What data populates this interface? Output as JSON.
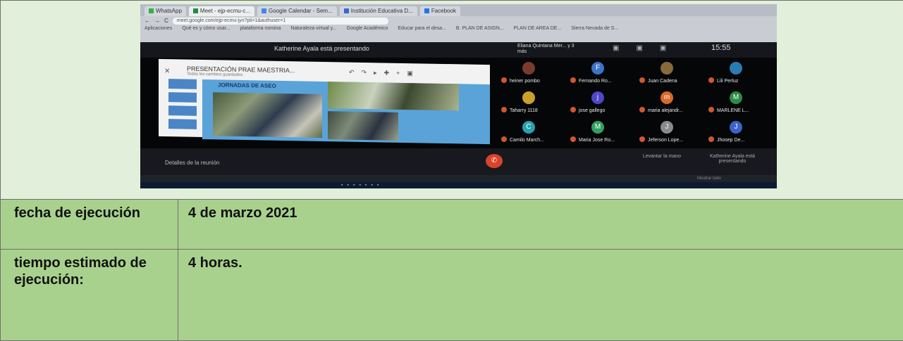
{
  "browser": {
    "tabs": [
      "WhatsApp",
      "Meet - ejp-ecmu-c...",
      "Google Calendar - Sem...",
      "Institución Educativa D...",
      "Facebook"
    ],
    "url": "meet.google.com/ejp-ecmu-jyn?pli=1&authuser=1",
    "bookmarks": [
      "Aplicaciones",
      "Qué es y cómo usar...",
      "plataforma nomina",
      "Naturaleza virtual y...",
      "Google Académico",
      "Educar para el desa...",
      "B. PLAN DE ASIGN...",
      "PLAN DE AREA DE...",
      "Sierra Nevada de S..."
    ]
  },
  "meet": {
    "presenting_text": "Katherine Ayala está presentando",
    "others_text": "Eliana Quintana Mer... y 3 más",
    "clock": "15:55",
    "presentation_title": "PRESENTACIÓN PRAE MAESTRIA...",
    "presentation_sub": "Todos los cambios guardados",
    "slide_title": "JORNADAS DE ASEO",
    "details_label": "Detalles de la reunión",
    "raise_hand_label": "Levantar la mano",
    "presenting_label": "Katherine Ayala está presentando",
    "participants": [
      {
        "initial": "",
        "name": "heiner pombo",
        "color": "#7a3b2e"
      },
      {
        "initial": "F",
        "name": "Fernando Ro...",
        "color": "#3b73c8"
      },
      {
        "initial": "",
        "name": "Juan Cadena",
        "color": "#8a6a3a"
      },
      {
        "initial": "",
        "name": "Lili Perluz",
        "color": "#2b7bb0"
      },
      {
        "initial": "",
        "name": "Taharry 1118",
        "color": "#caa02a"
      },
      {
        "initial": "j",
        "name": "jose gallego",
        "color": "#4f46c9"
      },
      {
        "initial": "m",
        "name": "maria alejandr...",
        "color": "#d86a2a"
      },
      {
        "initial": "M",
        "name": "MARLENE L...",
        "color": "#2e8a4a"
      },
      {
        "initial": "C",
        "name": "Camilo March...",
        "color": "#2aa1b0"
      },
      {
        "initial": "M",
        "name": "Maria Jose Ro...",
        "color": "#32a060"
      },
      {
        "initial": "J",
        "name": "Jeferson Lope...",
        "color": "#8a8a8a"
      },
      {
        "initial": "J",
        "name": "Jhosep De...",
        "color": "#3b63c8"
      }
    ],
    "downloads_text": "Mostrar todo"
  },
  "table": {
    "rows": [
      {
        "label": "fecha de ejecución",
        "value": "4 de marzo 2021"
      },
      {
        "label": "tiempo estimado de ejecución:",
        "value": "4 horas."
      }
    ]
  }
}
